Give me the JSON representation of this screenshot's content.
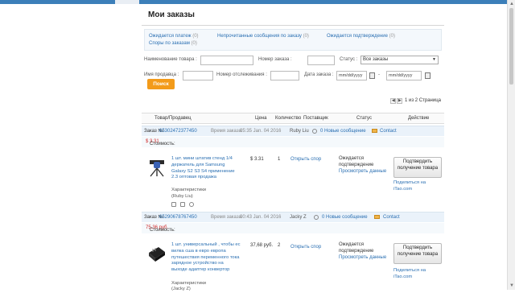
{
  "page": {
    "title": "Мои заказы"
  },
  "status_filters": [
    {
      "label": "Ожидается платеж",
      "count": "(0)"
    },
    {
      "label": "Непрочитанные сообщения по заказу",
      "count": "(0)"
    },
    {
      "label": "Ожидается подтверждение",
      "count": "(0)"
    },
    {
      "label": "Споры по заказам",
      "count": "(0)"
    }
  ],
  "search": {
    "product_label": "Наименование товара :",
    "order_no_label": "Номер заказа :",
    "status_label": "Статус :",
    "status_value": "Все заказы",
    "seller_label": "Имя продавца :",
    "tracking_label": "Номер отслеживания :",
    "date_label": "Дата заказа :",
    "date_from_placeholder": "mm/dd/yyyy",
    "date_to_placeholder": "mm/dd/yyyy",
    "date_sep": "-",
    "button": "Поиск"
  },
  "pager": {
    "prev": "◀",
    "next": "▶",
    "text": "1 из 2 Страница"
  },
  "table": {
    "headers": {
      "product": "Товар/Продавец",
      "price": "Цена",
      "qty": "Количество",
      "supplier": "Поставщик",
      "status": "Статус",
      "action": "Действие"
    }
  },
  "orders": [
    {
      "order_no_label": "Заказ №:",
      "order_no": "65302472377450",
      "time_label": "Время заказа:",
      "time": "05:35 Jan. 04 2016",
      "seller": "Ruby Liu",
      "new_messages": "0 Новые сообщение",
      "contact": "Contact",
      "cost_label": "Стоимость:",
      "cost": "$ 3.31",
      "product_title": "1 шт. мини штатив стенд 1/4 держатель для Samsung Galaxy S2 S3 S4 применение 2.3 оптовая продажа",
      "characteristics": "Характеристики",
      "product_seller": "(Ruby Liu)",
      "price": "$ 3.31",
      "qty": "1",
      "dispute": "Открыть спор",
      "status": "Ожидается подтверждение",
      "view_details": "Просмотреть данные",
      "confirm_button": "Подтвердить получение товара",
      "partner_line1": "Поделиться на",
      "partner_line2": "iTao.com"
    },
    {
      "order_no_label": "Заказ №:",
      "order_no": "65290678767450",
      "time_label": "Время заказа:",
      "time": "00:43 Jan. 04 2016",
      "seller": "Jacky Z",
      "new_messages": "0 Новые сообщение",
      "contact": "Contact",
      "cost_label": "Стоимость:",
      "cost": "75,36 руб.",
      "product_title": "1 шт. универсальный , чтобы ес вилка сша в евро европа путешествия переменного тока зарядное устройство на выходе адаптер конвертор",
      "characteristics": "Характеристики",
      "product_seller": "(Jacky Z)",
      "price": "37,68 руб.",
      "qty": "2",
      "dispute": "Открыть спор",
      "status": "Ожидается подтверждение",
      "view_details": "Просмотреть данные",
      "confirm_button": "Подтвердить получение товара",
      "partner_line1": "Поделиться на",
      "partner_line2": "iTao.com"
    }
  ],
  "colors": {
    "link": "#2a6fb2",
    "accent": "#f39b1a",
    "price_red": "#d02b2b",
    "header_blue": "#eaf2fa"
  }
}
